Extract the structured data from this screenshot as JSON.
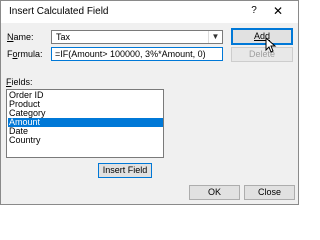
{
  "window": {
    "title": "Insert Calculated Field",
    "help_label": "?",
    "close_label": "✕"
  },
  "name": {
    "label": "Name:",
    "value": "Tax"
  },
  "formula": {
    "label": "Formula:",
    "value": "=IF(Amount> 100000, 3%*Amount, 0)"
  },
  "buttons": {
    "add": "Add",
    "delete": "Delete",
    "insert_field": "Insert Field",
    "ok": "OK",
    "close": "Close"
  },
  "fields": {
    "label": "Fields:",
    "items": [
      "Order ID",
      "Product",
      "Category",
      "Amount",
      "Date",
      "Country"
    ],
    "selected": "Amount"
  },
  "icons": {
    "dropdown": "chevron-down-icon",
    "pointer": "mouse-pointer-icon"
  }
}
